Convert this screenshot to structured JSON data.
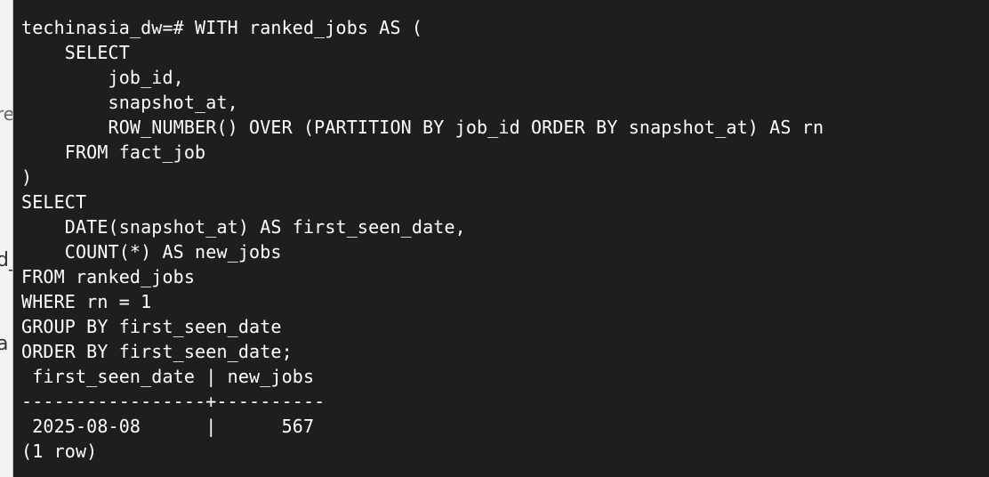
{
  "background_window": {
    "fragments": [
      "re",
      "d_",
      "a"
    ]
  },
  "terminal": {
    "lines": [
      "techinasia_dw=# WITH ranked_jobs AS (",
      "    SELECT",
      "        job_id,",
      "        snapshot_at,",
      "        ROW_NUMBER() OVER (PARTITION BY job_id ORDER BY snapshot_at) AS rn",
      "    FROM fact_job",
      ")",
      "SELECT",
      "    DATE(snapshot_at) AS first_seen_date,",
      "    COUNT(*) AS new_jobs",
      "FROM ranked_jobs",
      "WHERE rn = 1",
      "GROUP BY first_seen_date",
      "ORDER BY first_seen_date;",
      " first_seen_date | new_jobs",
      "-----------------+----------",
      " 2025-08-08      |      567",
      "(1 row)"
    ]
  },
  "colors": {
    "terminal_bg": "#1e1e1e",
    "terminal_text": "#ffffff",
    "background_window_bg": "#f3f3f3"
  }
}
